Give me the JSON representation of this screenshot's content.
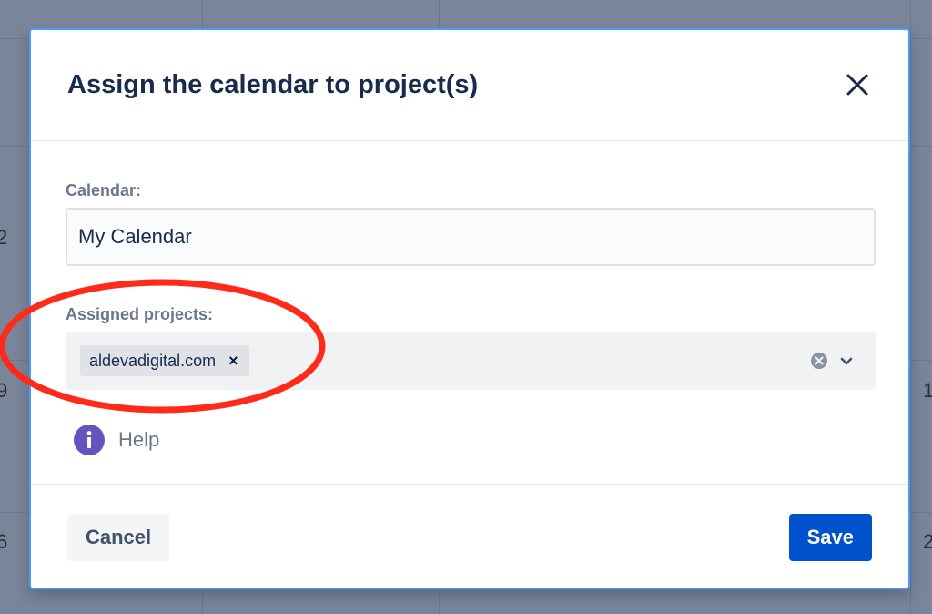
{
  "background": {
    "day_numbers": [
      "2",
      "9",
      "6",
      "1",
      "2"
    ]
  },
  "dialog": {
    "title": "Assign the calendar to project(s)",
    "close_icon": "close-icon"
  },
  "form": {
    "calendar_label": "Calendar:",
    "calendar_value": "My Calendar",
    "projects_label": "Assigned projects:",
    "selected_projects": [
      "aldevadigital.com"
    ],
    "tag_remove_symbol": "×",
    "help_text": "Help",
    "help_icon": "info-icon"
  },
  "footer": {
    "cancel_label": "Cancel",
    "save_label": "Save"
  },
  "colors": {
    "primary": "#0052cc",
    "focus_border": "#4c9aff",
    "info": "#6554c0",
    "annotation": "#ff2a1a"
  }
}
